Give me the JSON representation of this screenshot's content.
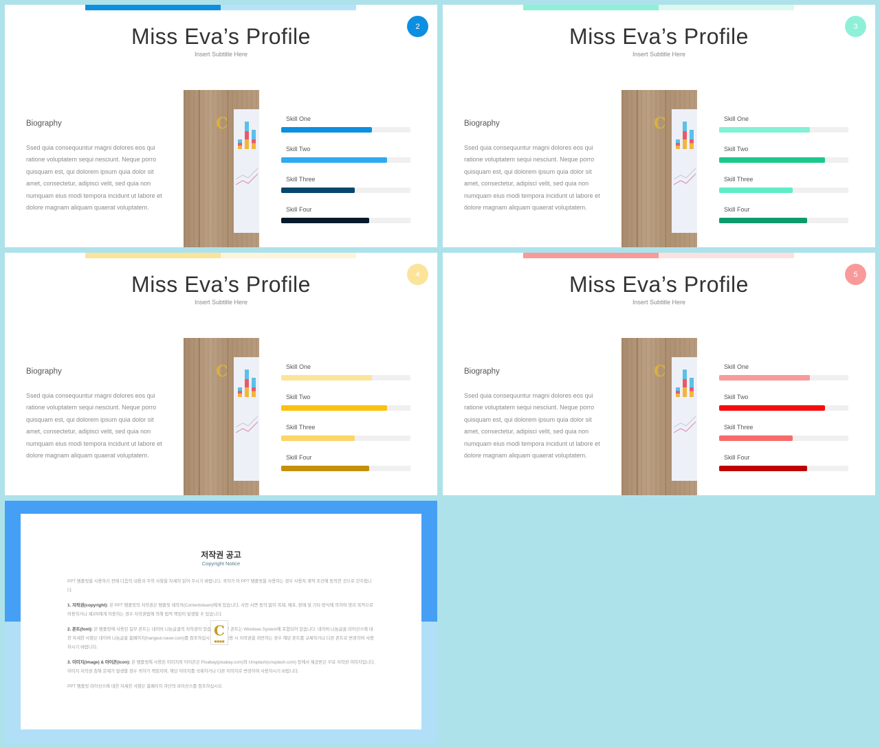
{
  "slides": [
    {
      "page_number": "2",
      "title": "Miss Eva’s Profile",
      "subtitle": "Insert Subtitle Here",
      "biography_heading": "Biography",
      "biography_text": "Ssed quia consequuntur magni dolores eos qui ratione voluptatem sequi nesciunt. Neque porro quisquam est, qui dolorem ipsum quia dolor sit amet, consectetur, adipisci velit, sed quia non numquam eius modi tempora incidunt ut labore et dolore magnam aliquam quaerat voluptatem.",
      "theme": {
        "accent": "#0c8fe0",
        "accent_light": "#b6e3fa",
        "badge": "#0c8fe0"
      },
      "skills": [
        {
          "label": "Skill One",
          "level": 0.7,
          "color": "#0b8fe0"
        },
        {
          "label": "Skill Two",
          "level": 0.82,
          "color": "#2eaaf0"
        },
        {
          "label": "Skill Three",
          "level": 0.57,
          "color": "#06466e"
        },
        {
          "label": "Skill Four",
          "level": 0.68,
          "color": "#051a2b"
        }
      ]
    },
    {
      "page_number": "3",
      "title": "Miss Eva’s Profile",
      "subtitle": "Insert Subtitle Here",
      "biography_heading": "Biography",
      "biography_text": "Ssed quia consequuntur magni dolores eos qui ratione voluptatem sequi nesciunt. Neque porro quisquam est, qui dolorem ipsum quia dolor sit amet, consectetur, adipisci velit, sed quia non numquam eius modi tempora incidunt ut labore et dolore magnam aliquam quaerat voluptatem.",
      "theme": {
        "accent": "#8ff0d8",
        "accent_light": "#dcf9f1",
        "badge": "#8ff0d8"
      },
      "skills": [
        {
          "label": "Skill One",
          "level": 0.7,
          "color": "#84f0d6"
        },
        {
          "label": "Skill Two",
          "level": 0.82,
          "color": "#1bc98a"
        },
        {
          "label": "Skill Three",
          "level": 0.57,
          "color": "#5fedc8"
        },
        {
          "label": "Skill Four",
          "level": 0.68,
          "color": "#0e9a6c"
        }
      ]
    },
    {
      "page_number": "4",
      "title": "Miss Eva’s Profile",
      "subtitle": "Insert Subtitle Here",
      "biography_heading": "Biography",
      "biography_text": "Ssed quia consequuntur magni dolores eos qui ratione voluptatem sequi nesciunt. Neque porro quisquam est, qui dolorem ipsum quia dolor sit amet, consectetur, adipisci velit, sed quia non numquam eius modi tempora incidunt ut labore et dolore magnam aliquam quaerat voluptatem.",
      "theme": {
        "accent": "#fce39a",
        "accent_light": "#fdf4d9",
        "badge": "#fce39a"
      },
      "skills": [
        {
          "label": "Skill One",
          "level": 0.7,
          "color": "#fde49b"
        },
        {
          "label": "Skill Two",
          "level": 0.82,
          "color": "#fcc20e"
        },
        {
          "label": "Skill Three",
          "level": 0.57,
          "color": "#fbd666"
        },
        {
          "label": "Skill Four",
          "level": 0.68,
          "color": "#c58f0a"
        }
      ]
    },
    {
      "page_number": "5",
      "title": "Miss Eva’s Profile",
      "subtitle": "Insert Subtitle Here",
      "biography_heading": "Biography",
      "biography_text": "Ssed quia consequuntur magni dolores eos qui ratione voluptatem sequi nesciunt. Neque porro quisquam est, qui dolorem ipsum quia dolor sit amet, consectetur, adipisci velit, sed quia non numquam eius modi tempora incidunt ut labore et dolore magnam aliquam quaerat voluptatem.",
      "theme": {
        "accent": "#f99a9a",
        "accent_light": "#fde0e0",
        "badge": "#f99a9a"
      },
      "skills": [
        {
          "label": "Skill One",
          "level": 0.7,
          "color": "#f99a9a"
        },
        {
          "label": "Skill Two",
          "level": 0.82,
          "color": "#f50d0d"
        },
        {
          "label": "Skill Three",
          "level": 0.57,
          "color": "#f76b6b"
        },
        {
          "label": "Skill Four",
          "level": 0.68,
          "color": "#bf0000"
        }
      ]
    }
  ],
  "copyright": {
    "title": "저작권 공고",
    "subtitle": "Copyright Notice",
    "logo_letter": "C",
    "paragraphs": [
      {
        "bold": "",
        "text": "PPT 템플릿을 사용하기 전에 다음의 내용과 주의 사항을 자세히 읽어 주시기 바랍니다. 귀하가 이 PPT 템플릿을 사용하는 경우 사용자 계약 조건에 동의한 것으로 간주됩니다."
      },
      {
        "bold": "1. 저작권(copyright): ",
        "text": "본 PPT 템플릿의 저작권은 템플릿 제작자(Contentsteam)에게 있습니다. 사전 서면 동의 없이 복제, 배포, 판매 및 기타 방식에 의하여 영리 목적으로 이용하거나 제3자에게 이용하는 경우 저작권법에 의해 법적 책임이 발생할 수 있습니다."
      },
      {
        "bold": "2. 폰트(font): ",
        "text": "본 템플릿에 사용된 일부 폰트는 네이버 나눔글꼴의 저작권이 있습니다. 일부 폰트는 Windows System에 포함되어 있습니다. 네이버 나눔글꼴 라이선스에 대한 자세한 사항은 네이버 나눔글꼴 홈페이지(hangeul.naver.com)를 참조하십시오. 폰트 사용 시 저작권을 위반하는 경우 해당 폰트를 교체하거나 다른 폰트로 변경하여 사용하시기 바랍니다."
      },
      {
        "bold": "3. 이미지(image) & 아이콘(icon): ",
        "text": "본 템플릿에 사용된 이미지와 아이콘은 Pixabay(pixabay.com)와 Unsplash(unsplash.com) 등에서 제공받은 무료 저작권 이미지입니다. 이미지 저작권 침해 문제가 발생할 경우 귀하가 책임지며, 해당 이미지를 삭제하거나 다른 이미지로 변경하여 사용하시기 바랍니다."
      },
      {
        "bold": "",
        "text": "PPT 템플릿 라이선스에 대한 자세한 사항은 홈페이지 하단의 라이선스를 참조하십시오."
      }
    ],
    "colors": {
      "top_band": "#45a0f5",
      "bottom_band": "#b1dff8"
    }
  }
}
